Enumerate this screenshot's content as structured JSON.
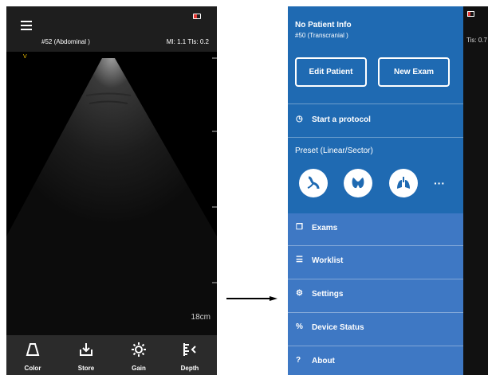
{
  "left_screen": {
    "preset": "#52 (Abdominal )",
    "mi_tis": "MI: 1.1  TIs: 0.2",
    "marker": "V",
    "depth": "18cm",
    "toolbar": [
      {
        "label": "Color",
        "icon": "probe-icon"
      },
      {
        "label": "Store",
        "icon": "download-icon"
      },
      {
        "label": "Gain",
        "icon": "gain-icon"
      },
      {
        "label": "Depth",
        "icon": "depth-icon"
      }
    ]
  },
  "right_screen": {
    "patient_name": "No Patient Info",
    "preset": "#50 (Transcranial )",
    "edit_patient": "Edit Patient",
    "new_exam": "New Exam",
    "start_protocol": "Start a protocol",
    "preset_title": "Preset (Linear/Sector)",
    "preset_icons": [
      "vessel-icon",
      "thyroid-icon",
      "lungs-icon"
    ],
    "more": "···",
    "menu": [
      {
        "label": "Exams",
        "icon": "exams-icon"
      },
      {
        "label": "Worklist",
        "icon": "worklist-icon"
      },
      {
        "label": "Settings",
        "icon": "settings-icon"
      },
      {
        "label": "Device Status",
        "icon": "device-status-icon"
      },
      {
        "label": "About",
        "icon": "about-icon"
      }
    ],
    "strip_text": "Tis: 0.7"
  },
  "colors": {
    "drawer_top": "#1f6ab2",
    "drawer_bottom": "#3e78c4",
    "battery": "#e53935",
    "marker": "#f5c400"
  }
}
